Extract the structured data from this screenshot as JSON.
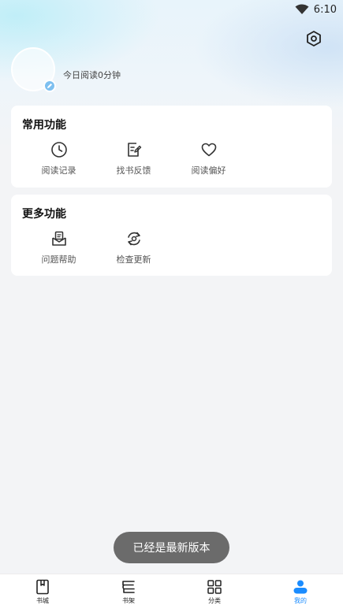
{
  "status_bar": {
    "time": "6:10",
    "wifi_icon": "wifi-icon"
  },
  "header": {
    "settings_icon": "hexagon-settings-icon"
  },
  "profile": {
    "read_today": "今日阅读0分钟",
    "avatar_icon": "avatar",
    "edit_icon": "pencil-icon"
  },
  "common_functions": {
    "title": "常用功能",
    "items": [
      {
        "label": "阅读记录",
        "icon": "clock-icon"
      },
      {
        "label": "找书反馈",
        "icon": "edit-document-icon"
      },
      {
        "label": "阅读偏好",
        "icon": "heart-icon"
      }
    ]
  },
  "more_functions": {
    "title": "更多功能",
    "items": [
      {
        "label": "问题帮助",
        "icon": "inbox-help-icon"
      },
      {
        "label": "检查更新",
        "icon": "refresh-update-icon"
      }
    ]
  },
  "toast": {
    "message": "已经是最新版本"
  },
  "bottom_nav": {
    "items": [
      {
        "label": "书城",
        "icon": "book-bookmark-icon",
        "active": false
      },
      {
        "label": "书架",
        "icon": "bookshelf-icon",
        "active": false
      },
      {
        "label": "分类",
        "icon": "grid-icon",
        "active": false
      },
      {
        "label": "我的",
        "icon": "user-icon",
        "active": true
      }
    ],
    "active_color": "#1a8cff"
  }
}
